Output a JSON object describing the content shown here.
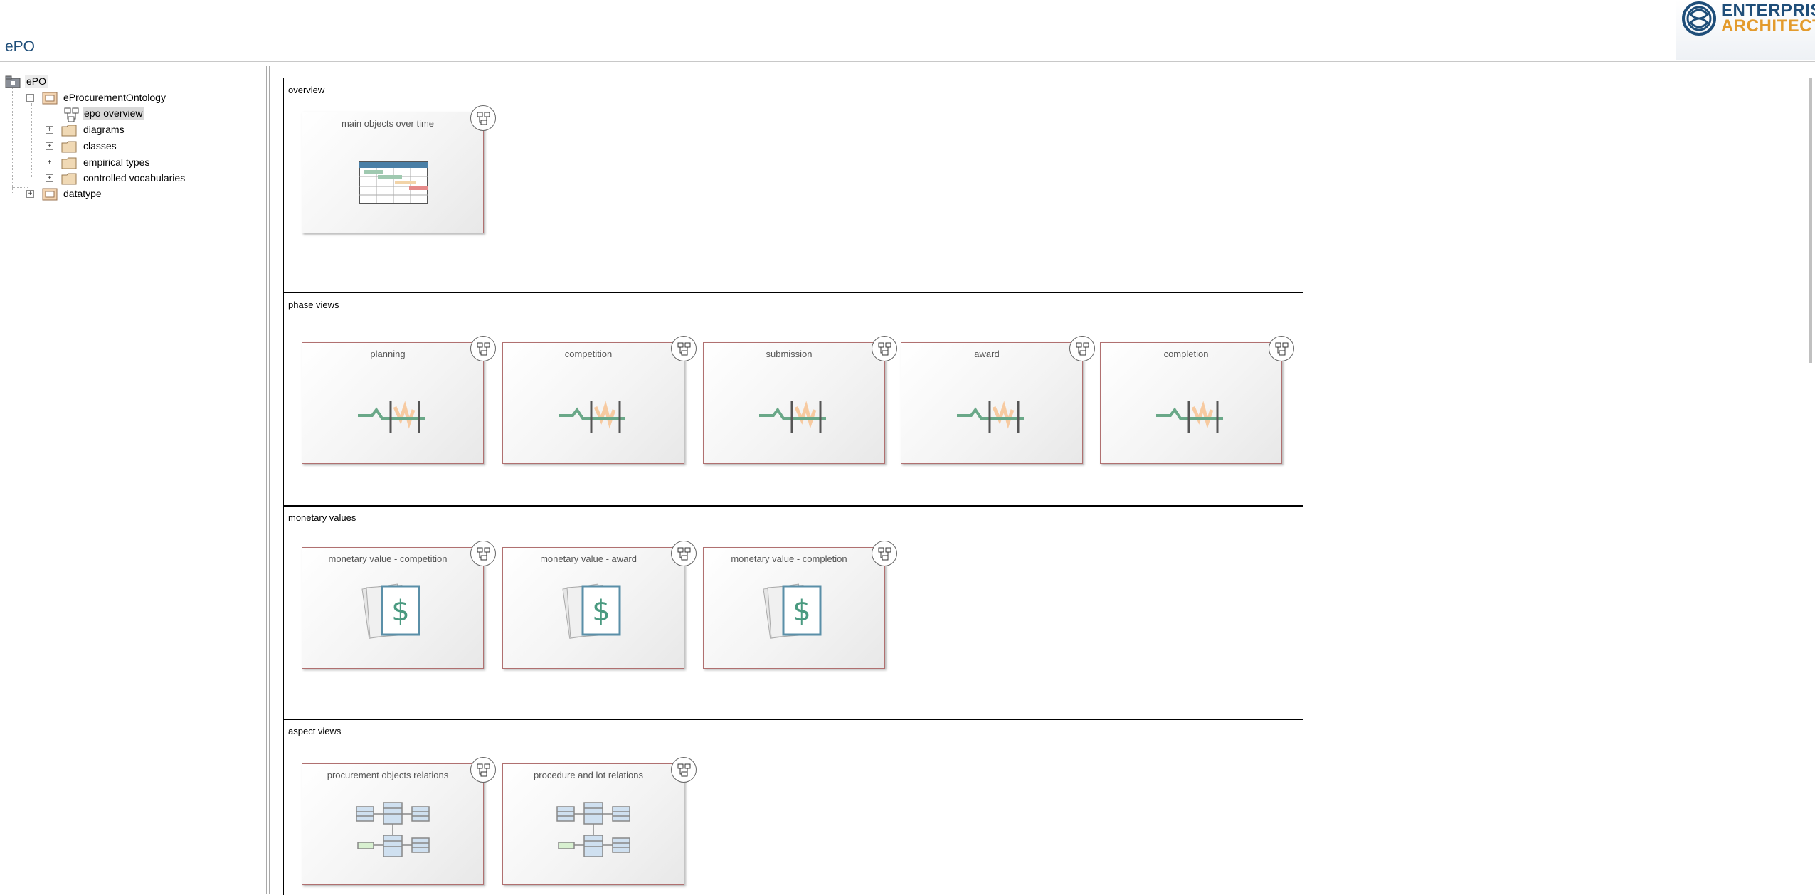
{
  "page": {
    "title": "ePO"
  },
  "logo": {
    "line1": "ENTERPRISE",
    "line2": "ARCHITECT",
    "icon": "enterprise-architect-logo-icon"
  },
  "tree": {
    "root": "ePO",
    "package": "eProcurementOntology",
    "selected_diagram": "epo overview",
    "folders": [
      "diagrams",
      "classes",
      "empirical types",
      "controlled vocabularies"
    ],
    "sibling_package": "datatype"
  },
  "sections": [
    {
      "header": "overview",
      "cards": [
        {
          "title": "main objects over time",
          "art": "gantt-chart-icon"
        }
      ]
    },
    {
      "header": "phase views",
      "cards": [
        {
          "title": "planning",
          "art": "timeline-icon"
        },
        {
          "title": "competition",
          "art": "timeline-icon"
        },
        {
          "title": "submission",
          "art": "timeline-icon"
        },
        {
          "title": "award",
          "art": "timeline-icon"
        },
        {
          "title": "completion",
          "art": "timeline-icon"
        }
      ]
    },
    {
      "header": "monetary values",
      "cards": [
        {
          "title": "monetary value - competition",
          "art": "dollar-documents-icon"
        },
        {
          "title": "monetary value - award",
          "art": "dollar-documents-icon"
        },
        {
          "title": "monetary value - completion",
          "art": "dollar-documents-icon"
        }
      ]
    },
    {
      "header": "aspect views",
      "cards": [
        {
          "title": "procurement objects relations",
          "art": "class-diagram-icon"
        },
        {
          "title": "procedure and lot relations",
          "art": "class-diagram-icon"
        }
      ]
    }
  ],
  "colors": {
    "title_blue": "#1f4e79",
    "logo_orange": "#e39b2d",
    "card_border": "#b07070",
    "timeline_green": "#6aa888",
    "dollar_teal": "#4a9a80"
  }
}
